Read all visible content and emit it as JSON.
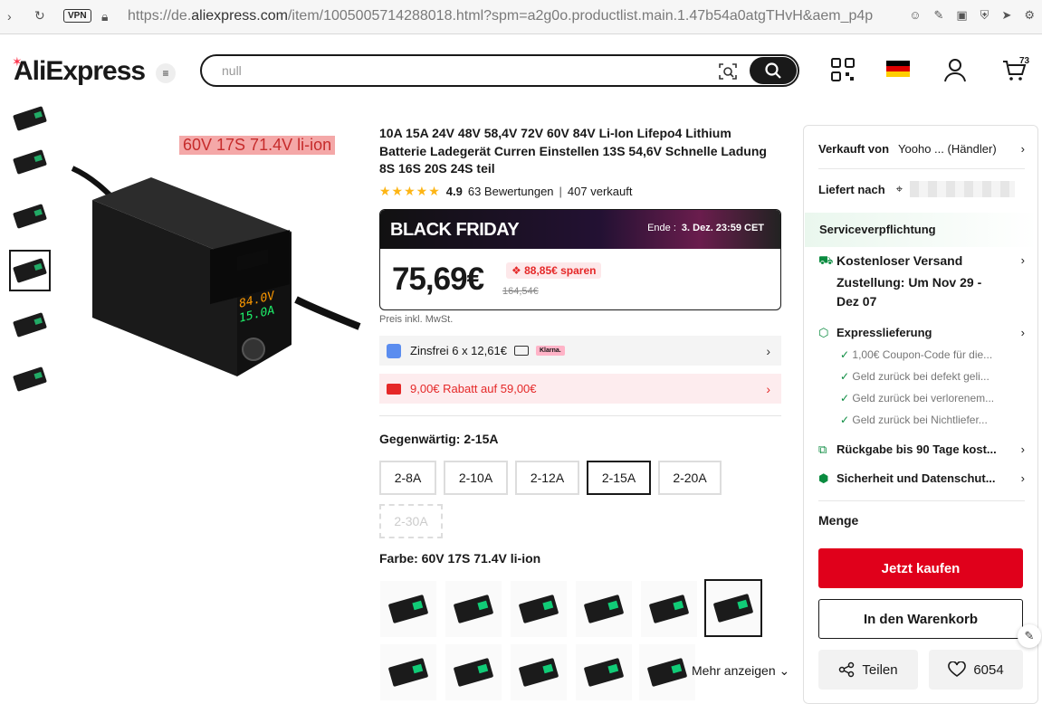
{
  "browser": {
    "vpn_label": "VPN",
    "url_prefix": "https://de.",
    "url_domain": "aliexpress.com",
    "url_rest": "/item/1005005714288018.html?spm=a2g0o.productlist.main.1.47b54a0atgTHvH&aem_p4p"
  },
  "header": {
    "logo": "AliExpress",
    "search_placeholder": "null",
    "cart_count": "73"
  },
  "product": {
    "image_tag": "60V 17S 71.4V li-ion",
    "title": "10A 15A 24V 48V 58,4V 72V 60V 84V Li-Ion Lifepo4 Lithium Batterie Ladegerät Curren Einstellen 13S 54,6V Schnelle Ladung 8S 16S 20S 24S teil",
    "stars": "★★★★★",
    "rating": "4.9",
    "reviews": "63 Bewertungen",
    "rating_sep": "|",
    "sold": "407 verkauft"
  },
  "deal": {
    "title": "BLACK FRIDAY",
    "ends_label": "Ende :",
    "ends_value": "3. Dez. 23:59 CET",
    "price": "75,69€",
    "save": "88,85€ sparen",
    "original": "164,54€",
    "tax_note": "Preis inkl. MwSt."
  },
  "payment": {
    "installment": "Zinsfrei 6 x 12,61€",
    "klarna": "Klarna.",
    "discount": "9,00€ Rabatt auf 59,00€"
  },
  "options": {
    "current_label": "Gegenwärtig: 2-15A",
    "sizes": [
      "2-8A",
      "2-10A",
      "2-12A",
      "2-15A",
      "2-20A",
      "2-30A"
    ],
    "color_label": "Farbe: 60V 17S 71.4V li-ion",
    "more": "Mehr anzeigen"
  },
  "panel": {
    "seller_label": "Verkauft von",
    "seller_value": "Yooho ... (Händler)",
    "ship_to_label": "Liefert nach",
    "service_title": "Serviceverpflichtung",
    "free_ship": "Kostenloser Versand",
    "delivery": "Zustellung: Um Nov 29 - Dez 07",
    "express": "Expresslieferung",
    "benefits": [
      "1,00€ Coupon-Code für die...",
      "Geld zurück bei defekt geli...",
      "Geld zurück bei verlorenem...",
      "Geld zurück bei Nichtliefer..."
    ],
    "returns": "Rückgabe bis 90 Tage kost...",
    "security": "Sicherheit und Datenschut...",
    "quantity": "Menge",
    "buy_now": "Jetzt kaufen",
    "add_cart": "In den Warenkorb",
    "share": "Teilen",
    "wishlist_count": "6054"
  },
  "colors": {
    "accent": "#e0001b",
    "discount": "#e52828",
    "rating_star": "#fdb515",
    "service_green": "#0a8b3f"
  }
}
